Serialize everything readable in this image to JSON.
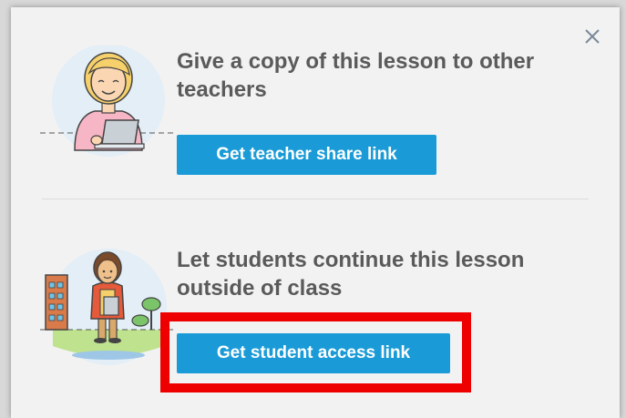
{
  "dialog": {
    "close_symbol": "×",
    "teacher_section": {
      "heading": "Give a copy of this lesson to other teachers",
      "button_label": "Get teacher share link",
      "illustration": "teacher-with-laptop-illustration"
    },
    "student_section": {
      "heading": "Let students continue this lesson outside of class",
      "button_label": "Get student access link",
      "illustration": "student-outdoors-illustration"
    }
  },
  "colors": {
    "button": "#1a9bd7",
    "heading_text": "#5a5a5a",
    "highlight_box": "#ee0000",
    "dialog_background": "#f2f2f2"
  }
}
